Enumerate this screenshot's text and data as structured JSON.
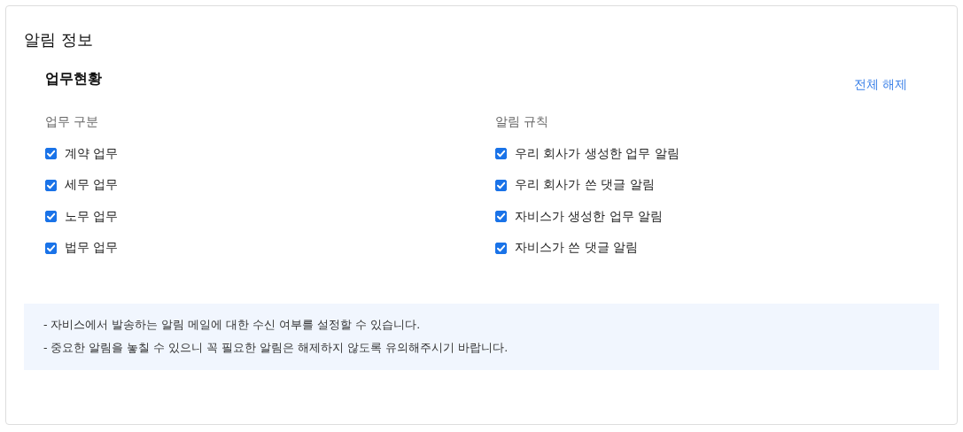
{
  "title": "알림 정보",
  "section": {
    "title": "업무현황",
    "clear_all_link": "전체 해제",
    "groups": [
      {
        "heading": "업무 구분",
        "options": [
          {
            "label": "계약 업무",
            "checked": true
          },
          {
            "label": "세무 업무",
            "checked": true
          },
          {
            "label": "노무 업무",
            "checked": true
          },
          {
            "label": "법무 업무",
            "checked": true
          }
        ]
      },
      {
        "heading": "알림 규칙",
        "options": [
          {
            "label": "우리 회사가 생성한 업무 알림",
            "checked": true
          },
          {
            "label": "우리 회사가 쓴 댓글 알림",
            "checked": true
          },
          {
            "label": "자비스가 생성한 업무 알림",
            "checked": true
          },
          {
            "label": "자비스가 쓴 댓글 알림",
            "checked": true
          }
        ]
      }
    ]
  },
  "notes": [
    "- 자비스에서 발송하는 알림 메일에 대한 수신 여부를 설정할 수 있습니다.",
    "- 중요한 알림을 놓칠 수 있으니 꼭 필요한 알림은 해제하지 않도록 유의해주시기 바랍니다."
  ]
}
